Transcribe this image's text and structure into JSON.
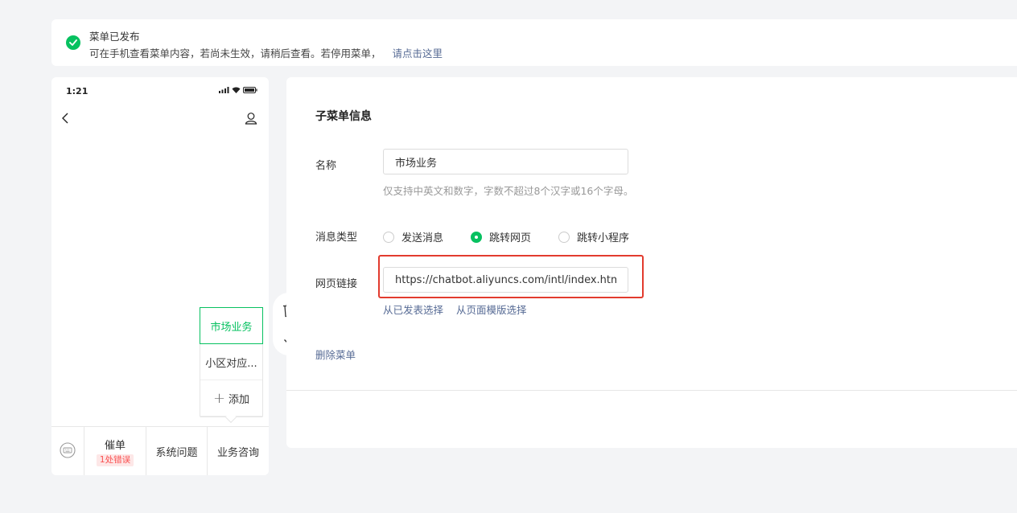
{
  "notice": {
    "title": "菜单已发布",
    "message": "可在手机查看菜单内容，若尚未生效，请稍后查看。若停用菜单，",
    "link": "请点击这里"
  },
  "phone": {
    "time": "1:21",
    "submenu": {
      "items": [
        "市场业务",
        "小区对应..."
      ],
      "add_label": "添加"
    },
    "tabs": [
      {
        "label": "催单",
        "badge": "1处错误"
      },
      {
        "label": "系统问题"
      },
      {
        "label": "业务咨询"
      }
    ]
  },
  "panel": {
    "title": "子菜单信息",
    "name_label": "名称",
    "name_value": "市场业务",
    "name_hint": "仅支持中英文和数字，字数不超过8个汉字或16个字母。",
    "type_label": "消息类型",
    "type_options": [
      "发送消息",
      "跳转网页",
      "跳转小程序"
    ],
    "type_selected": "跳转网页",
    "url_label": "网页链接",
    "url_value": "https://chatbot.aliyuncs.com/intl/index.htm?lo",
    "url_links": [
      "从已发表选择",
      "从页面模版选择"
    ],
    "delete_label": "删除菜单"
  },
  "colors": {
    "accent": "#07c160",
    "link": "#576b95",
    "error": "#fa5151",
    "highlight": "#e23b2e"
  }
}
